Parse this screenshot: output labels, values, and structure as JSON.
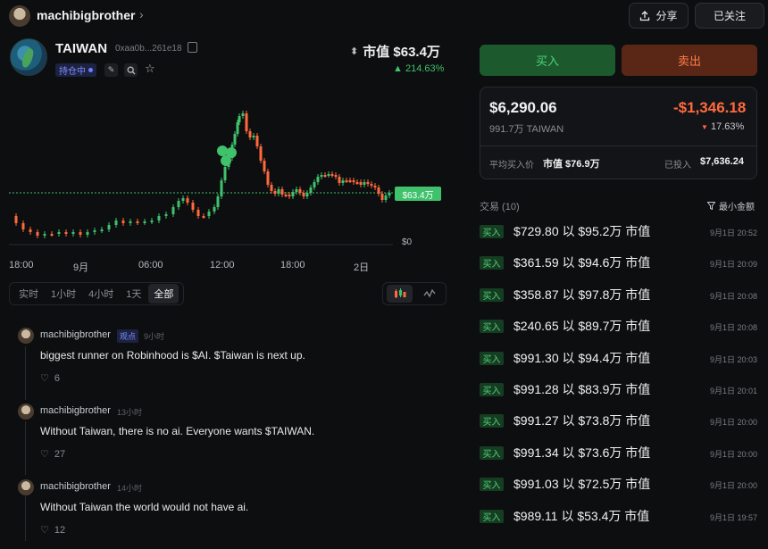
{
  "header": {
    "username": "machibigbrother",
    "share_label": "分享",
    "follow_label": "已关注"
  },
  "token": {
    "name": "TAIWAN",
    "address": "0xaa0b...261e18",
    "holding_badge": "持仓中",
    "market_cap": "市值 $63.4万",
    "change": "214.63%",
    "price_tag": "$63.4万",
    "zero_label": "$0"
  },
  "chart_data": {
    "type": "candlestick",
    "x_ticks": [
      "18:00",
      "9月",
      "06:00",
      "12:00",
      "18:00",
      "2日"
    ],
    "current_price_label": "$63.4万",
    "y_min_label": "$0",
    "trend": "rising",
    "up_color": "#3fc26b",
    "down_color": "#ff6a3d"
  },
  "timeframes": [
    "实时",
    "1小时",
    "4小时",
    "1天",
    "全部"
  ],
  "timeframe_selected": "全部",
  "comments": [
    {
      "user": "machibigbrother",
      "badge": "观点",
      "time": "9小时",
      "text": "biggest runner on Robinhood is $AI. $Taiwan is next up.",
      "likes": "6"
    },
    {
      "user": "machibigbrother",
      "badge": "",
      "time": "13小时",
      "text": "Without Taiwan, there is no ai. Everyone wants $TAIWAN.",
      "likes": "27"
    },
    {
      "user": "machibigbrother",
      "badge": "",
      "time": "14小时",
      "text": "Without Taiwan the world would not have ai.",
      "likes": "12"
    }
  ],
  "actions": {
    "buy": "买入",
    "sell": "卖出"
  },
  "position": {
    "value": "$6,290.06",
    "amount": "991.7万 TAIWAN",
    "pnl": "-$1,346.18",
    "pnl_pct": "17.63%",
    "avg_label": "平均买入价",
    "avg_value": "市值 $76.9万",
    "invested_label": "已投入",
    "invested_value": "$7,636.24"
  },
  "trades": {
    "title": "交易 (10)",
    "filter_label": "最小金额",
    "items": [
      {
        "side": "买入",
        "text": "$729.80 以 $95.2万 市值",
        "time": "9月1日 20:52"
      },
      {
        "side": "买入",
        "text": "$361.59 以 $94.6万 市值",
        "time": "9月1日 20:09"
      },
      {
        "side": "买入",
        "text": "$358.87 以 $97.8万 市值",
        "time": "9月1日 20:08"
      },
      {
        "side": "买入",
        "text": "$240.65 以 $89.7万 市值",
        "time": "9月1日 20:08"
      },
      {
        "side": "买入",
        "text": "$991.30 以 $94.4万 市值",
        "time": "9月1日 20:03"
      },
      {
        "side": "买入",
        "text": "$991.28 以 $83.9万 市值",
        "time": "9月1日 20:01"
      },
      {
        "side": "买入",
        "text": "$991.27 以 $73.8万 市值",
        "time": "9月1日 20:00"
      },
      {
        "side": "买入",
        "text": "$991.34 以 $73.6万 市值",
        "time": "9月1日 20:00"
      },
      {
        "side": "买入",
        "text": "$991.03 以 $72.5万 市值",
        "time": "9月1日 20:00"
      },
      {
        "side": "买入",
        "text": "$989.11 以 $53.4万 市值",
        "time": "9月1日 19:57"
      }
    ]
  }
}
